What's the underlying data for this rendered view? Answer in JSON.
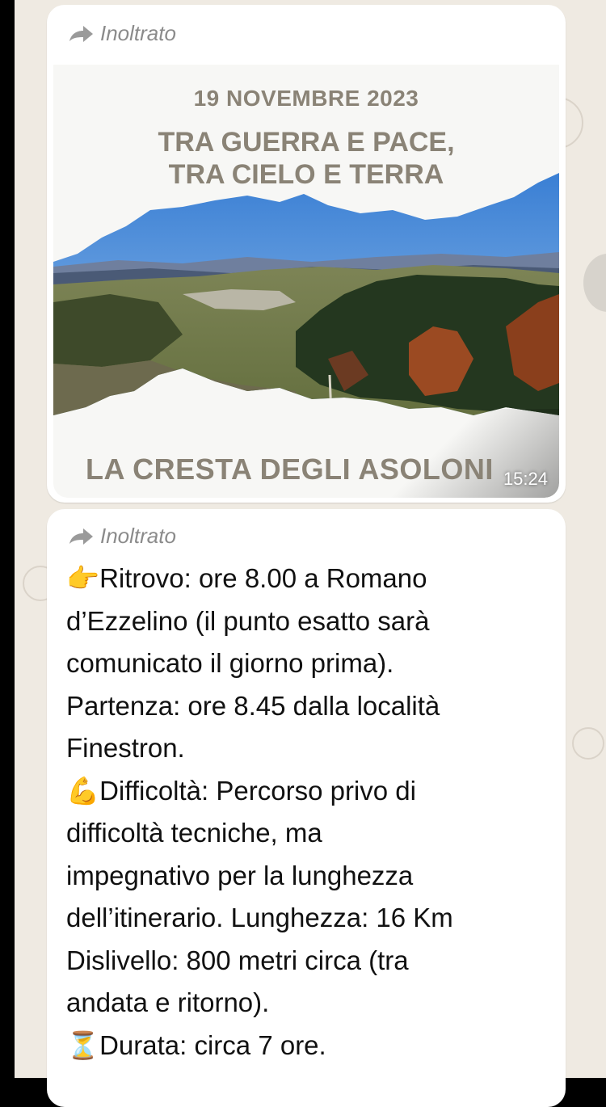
{
  "messages": [
    {
      "type": "image",
      "forwarded_label": "Inoltrato",
      "time": "15:24",
      "flyer": {
        "date": "19 NOVEMBRE 2023",
        "title_line1": "TRA GUERRA E PACE,",
        "title_line2": "TRA CIELO E TERRA",
        "subtitle": "LA CRESTA DEGLI ASOLONI"
      }
    },
    {
      "type": "text",
      "forwarded_label": "Inoltrato",
      "lines": [
        {
          "emoji": "👉",
          "text": "Ritrovo: ore 8.00 a Romano"
        },
        {
          "emoji": "",
          "text": "d’Ezzelino (il punto esatto sarà"
        },
        {
          "emoji": "",
          "text": "comunicato il giorno prima)."
        },
        {
          "emoji": "",
          "text": "Partenza: ore 8.45 dalla località"
        },
        {
          "emoji": "",
          "text": "Finestron."
        },
        {
          "emoji": "💪",
          "text": "Difficoltà: Percorso privo di"
        },
        {
          "emoji": "",
          "text": "difficoltà tecniche, ma"
        },
        {
          "emoji": "",
          "text": "impegnativo per la lunghezza"
        },
        {
          "emoji": "",
          "text": "dell’itinerario. Lunghezza: 16 Km"
        },
        {
          "emoji": "",
          "text": "Dislivello: 800 metri circa (tra"
        },
        {
          "emoji": "",
          "text": "andata e ritorno)."
        },
        {
          "emoji": "⏳",
          "text": "Durata: circa 7 ore."
        }
      ]
    }
  ],
  "icons": {
    "forward": "forward-arrow-icon"
  },
  "colors": {
    "chat_background": "#efeae2",
    "bubble": "#ffffff",
    "flyer_text": "#8a8376",
    "forwarded_text": "#8b8b8b"
  }
}
